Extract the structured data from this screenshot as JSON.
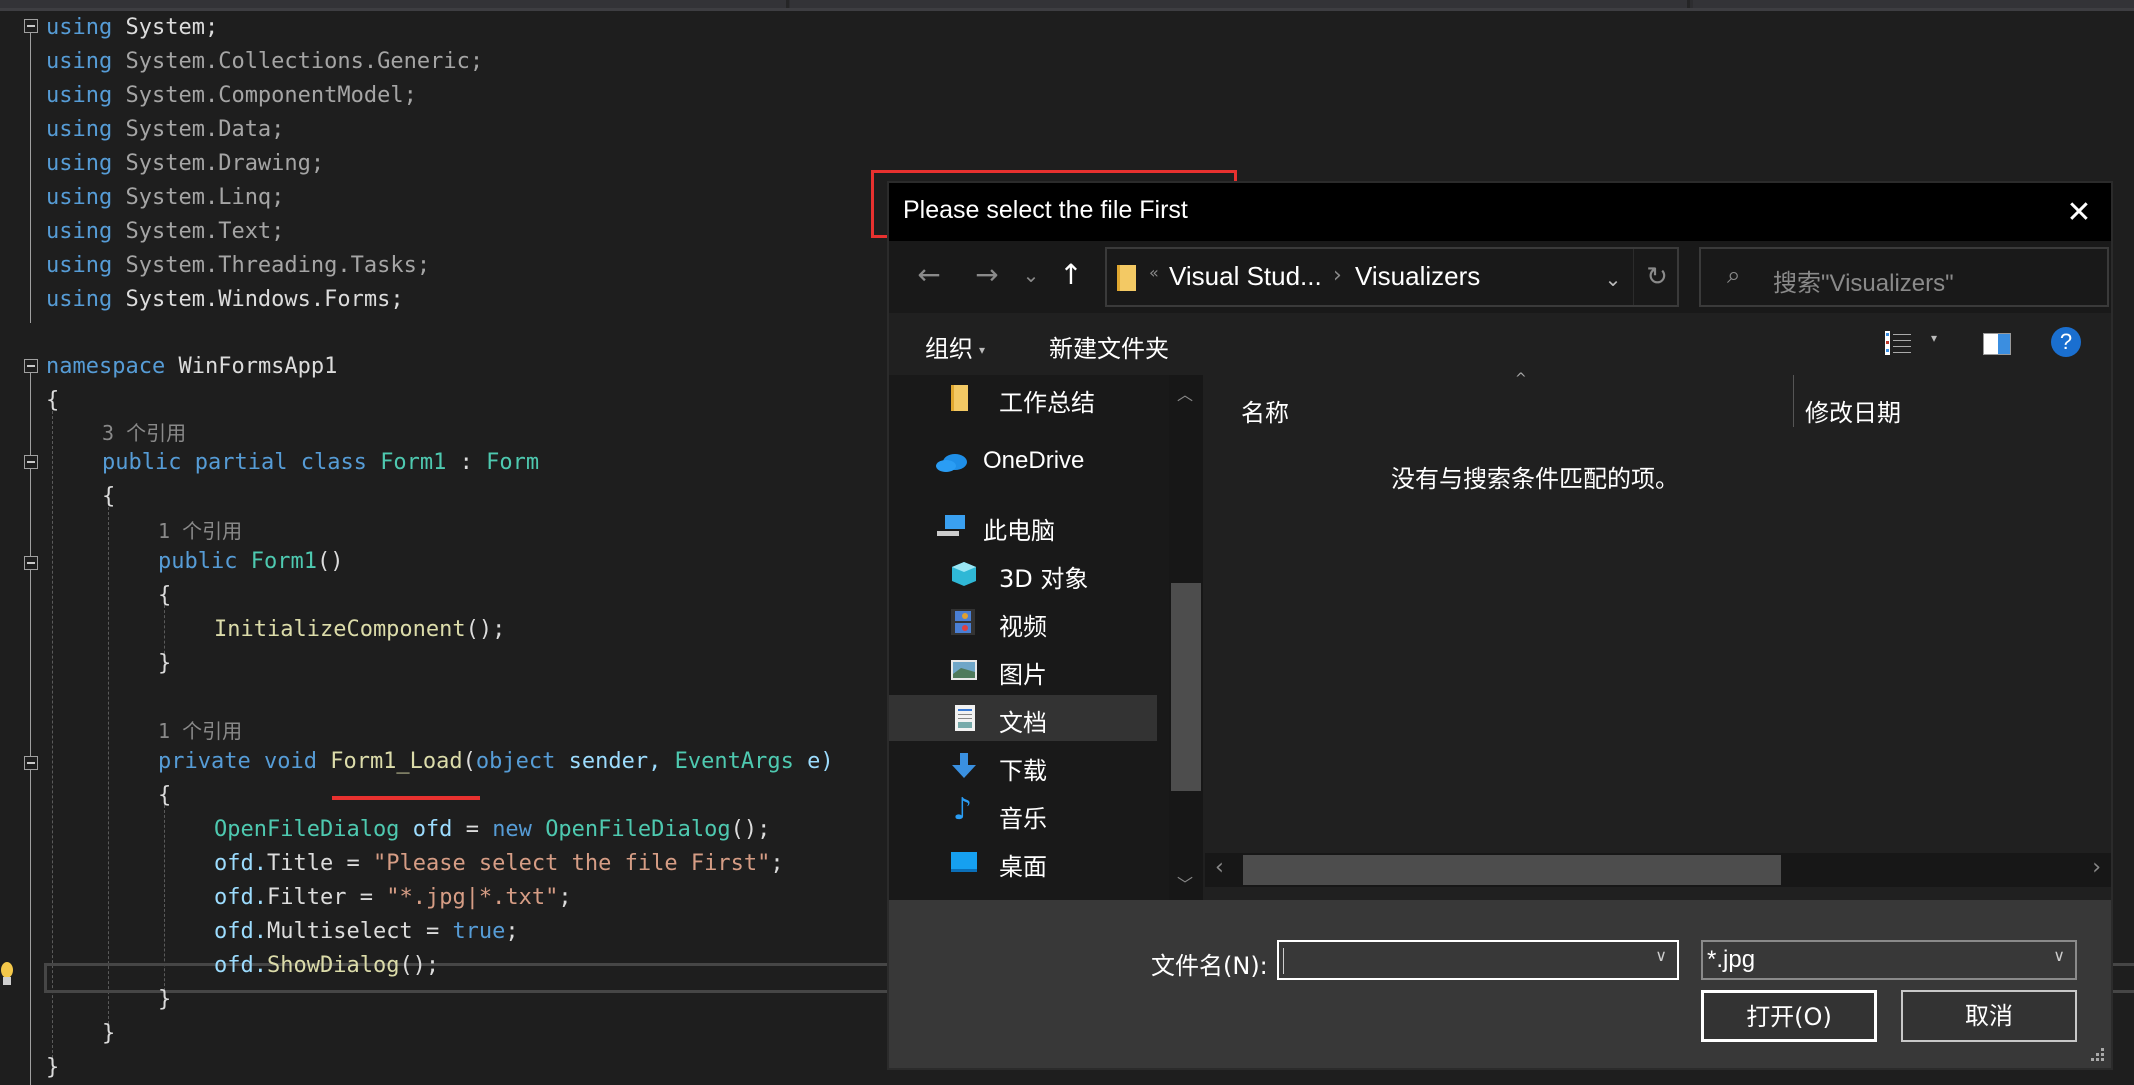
{
  "editor": {
    "lines": [
      {
        "parts": [
          [
            "kw",
            "using"
          ],
          [
            "",
            "System;"
          ]
        ]
      },
      {
        "parts": [
          [
            "kw",
            "using"
          ],
          [
            "dim",
            "System.Collections.Generic;"
          ]
        ]
      },
      {
        "parts": [
          [
            "kw",
            "using"
          ],
          [
            "dim",
            "System.ComponentModel;"
          ]
        ]
      },
      {
        "parts": [
          [
            "kw",
            "using"
          ],
          [
            "dim",
            "System.Data;"
          ]
        ]
      },
      {
        "parts": [
          [
            "kw",
            "using"
          ],
          [
            "dim",
            "System.Drawing;"
          ]
        ]
      },
      {
        "parts": [
          [
            "kw",
            "using"
          ],
          [
            "dim",
            "System.Linq;"
          ]
        ]
      },
      {
        "parts": [
          [
            "kw",
            "using"
          ],
          [
            "dim",
            "System.Text;"
          ]
        ]
      },
      {
        "parts": [
          [
            "kw",
            "using"
          ],
          [
            "dim",
            "System.Threading.Tasks;"
          ]
        ]
      },
      {
        "parts": [
          [
            "kw",
            "using"
          ],
          [
            "",
            "System.Windows.Forms;"
          ]
        ]
      }
    ],
    "namespace_kw": "namespace",
    "namespace_name": "WinFormsApp1",
    "open_brace": "{",
    "close_brace": "}",
    "codelens_class": "3 个引用",
    "class_decl": {
      "public": "public",
      "partial": "partial",
      "class": "class",
      "name": "Form1",
      "colon": ":",
      "base": "Form"
    },
    "codelens_ctor": "1 个引用",
    "ctor_decl": {
      "public": "public",
      "name": "Form1",
      "parens": "()"
    },
    "init_call": {
      "name": "InitializeComponent",
      "rest": "();"
    },
    "codelens_load": "1 个引用",
    "load_decl": {
      "private": "private",
      "void": "void",
      "name": "Form1_Load",
      "lparen": "(",
      "object": "object",
      "sender": "sender,",
      "eventargs": "EventArgs",
      "e": "e)"
    },
    "body": {
      "l1": {
        "type": "OpenFileDialog",
        "var": "ofd",
        "eq": "=",
        "new": "new",
        "type2": "OpenFileDialog",
        "rest": "();"
      },
      "l2": {
        "obj": "ofd.",
        "prop": "Title",
        "eq": "=",
        "str": "\"Please select the file First\"",
        "semi": ";"
      },
      "l3": {
        "obj": "ofd.",
        "prop": "Filter",
        "eq": "=",
        "str": "\"*.jpg|*.txt\"",
        "semi": ";"
      },
      "l4": {
        "obj": "ofd.",
        "prop": "Multiselect",
        "eq": "=",
        "val": "true",
        "semi": ";"
      },
      "l5": {
        "obj": "ofd.",
        "method": "ShowDialog",
        "rest": "();"
      }
    }
  },
  "dialog": {
    "title": "Please select the file First",
    "close_icon": "✕",
    "nav": {
      "back_icon": "←",
      "forward_icon": "→",
      "recent_icon": "⌄",
      "up_icon": "↑",
      "breadcrumb_overflow": "«",
      "breadcrumbs": [
        "Visual Stud...",
        "Visualizers"
      ],
      "breadcrumb_sep": "›",
      "dropdown_icon": "⌄",
      "refresh_icon": "↻"
    },
    "search": {
      "icon": "⌕",
      "placeholder": "搜索\"Visualizers\""
    },
    "toolbar": {
      "organize": "组织",
      "organize_caret": "▾",
      "new_folder": "新建文件夹",
      "view_caret": "▾",
      "help": "?"
    },
    "nav_pane": {
      "items": [
        {
          "label": "工作总结",
          "icon": "folder-icon"
        },
        {
          "label": "OneDrive",
          "icon": "onedrive-icon"
        },
        {
          "label": "此电脑",
          "icon": "computer-icon"
        },
        {
          "label": "3D 对象",
          "icon": "3d-objects-icon"
        },
        {
          "label": "视频",
          "icon": "videos-icon"
        },
        {
          "label": "图片",
          "icon": "pictures-icon"
        },
        {
          "label": "文档",
          "icon": "documents-icon",
          "selected": true
        },
        {
          "label": "下载",
          "icon": "downloads-icon"
        },
        {
          "label": "音乐",
          "icon": "music-icon"
        },
        {
          "label": "桌面",
          "icon": "desktop-icon"
        }
      ],
      "scroll_up": "︿",
      "scroll_down": "﹀"
    },
    "content": {
      "columns": [
        "名称",
        "修改日期"
      ],
      "sort_indicator": "^",
      "empty_message": "没有与搜索条件匹配的项。",
      "hscroll_left": "‹",
      "hscroll_right": "›"
    },
    "footer": {
      "filename_label": "文件名(N):",
      "filename_value": "",
      "filter_value": "*.jpg",
      "dropdown_icon": "∨",
      "open_button": "打开(O)",
      "cancel_button": "取消"
    }
  },
  "colors": {
    "keyword": "#569cd6",
    "type": "#4ec9b0",
    "method": "#dcdcaa",
    "string": "#d69d85",
    "annotation_red": "#e8312f",
    "help_blue": "#1a6fd0"
  }
}
